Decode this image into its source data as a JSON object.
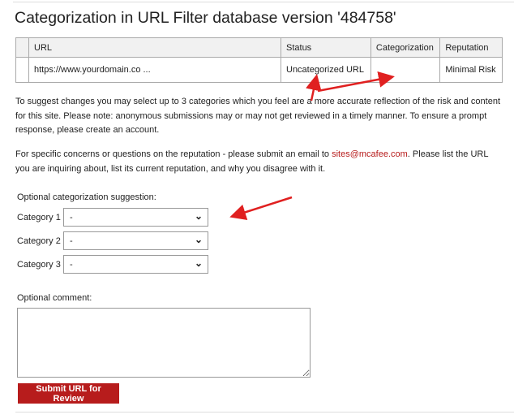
{
  "title": "Categorization in URL Filter database version '484758'",
  "table": {
    "headers": [
      "",
      "URL",
      "Status",
      "Categorization",
      "Reputation"
    ],
    "rows": [
      [
        "",
        "https://www.yourdomain.co ...",
        "Uncategorized URL",
        "",
        "Minimal Risk"
      ]
    ]
  },
  "info": {
    "p1": "To suggest changes you may select up to 3 categories which you feel are a more accurate reflection of the risk and content for this site. Please note: anonymous submissions may or may not get reviewed in a timely manner. To ensure a prompt response, please create an account.",
    "p2_before": "For specific concerns or questions on the reputation - please submit an email to ",
    "p2_link": "sites@mcafee.com",
    "p2_after": ". Please list the URL you are inquiring about, list its current reputation, and why you disagree with it."
  },
  "form": {
    "suggestion_label": "Optional categorization suggestion:",
    "categories": [
      {
        "label": "Category 1",
        "value": "-"
      },
      {
        "label": "Category 2",
        "value": "-"
      },
      {
        "label": "Category 3",
        "value": "-"
      }
    ],
    "comment_label": "Optional comment:",
    "comment_value": "",
    "submit_label": "Submit URL for Review"
  },
  "colors": {
    "accent": "#b71c1c",
    "annotation_arrow": "#e02020"
  }
}
